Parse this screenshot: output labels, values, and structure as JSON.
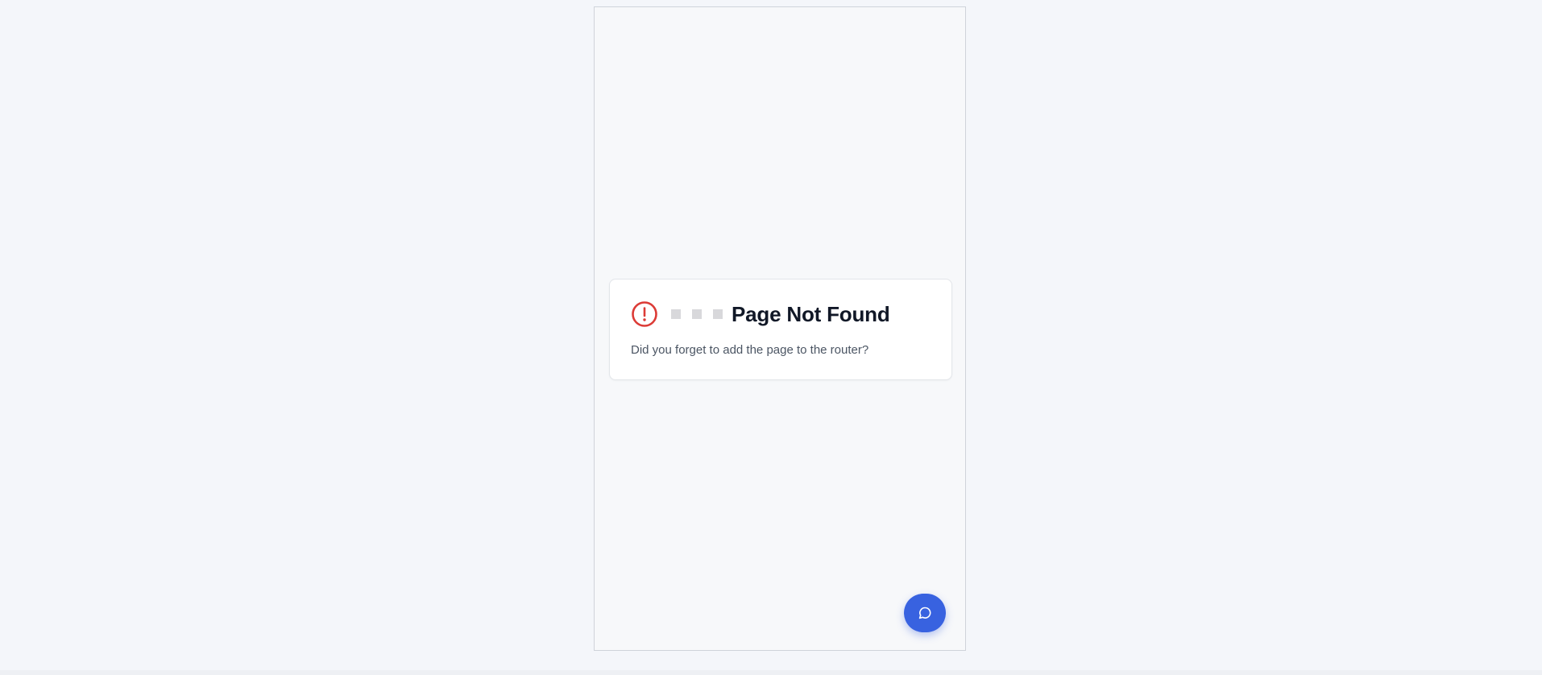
{
  "error_card": {
    "icon": "alert-circle-icon",
    "title": "Page Not Found",
    "message": "Did you forget to add the page to the router?"
  },
  "chat_button": {
    "icon": "chat-bubble-icon"
  },
  "colors": {
    "page_background": "#f4f6fa",
    "device_background": "#f7f8fa",
    "error_icon": "#dc3b36",
    "title_text": "#111827",
    "message_text": "#4b5563",
    "fab_background": "#3862e0"
  }
}
